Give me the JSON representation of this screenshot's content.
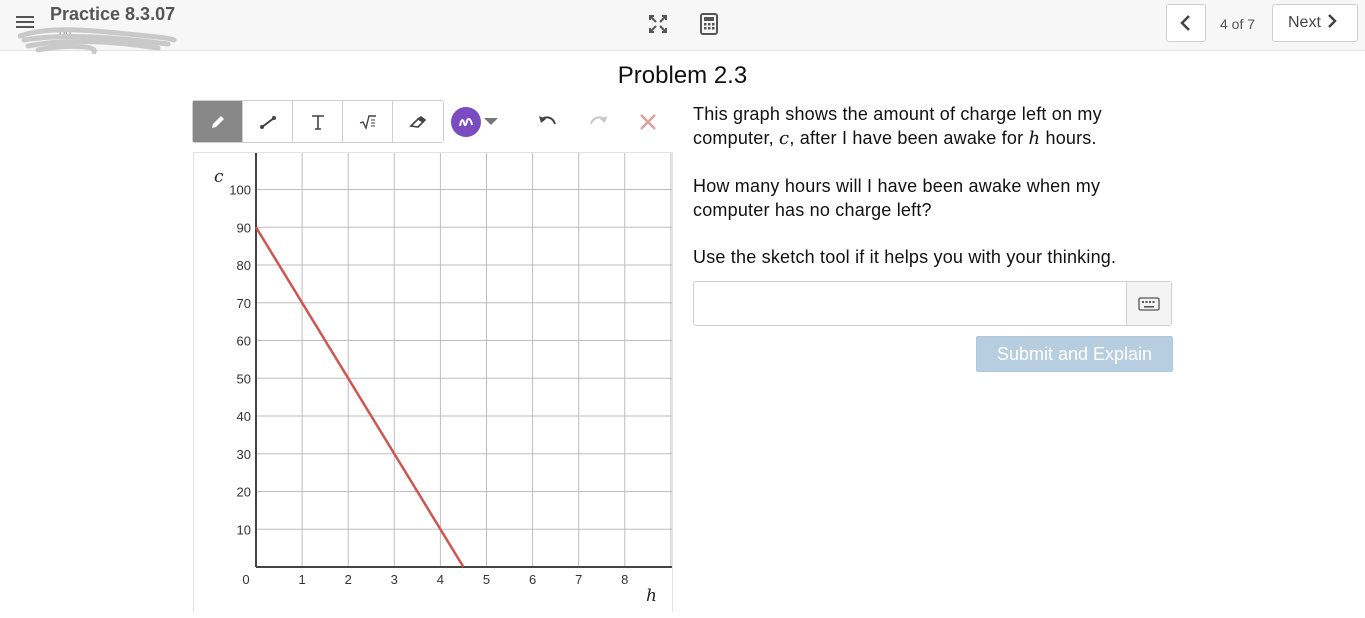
{
  "header": {
    "title": "Practice 8.3.07",
    "subtitle": "...on",
    "icons": {
      "menu": "hamburger-menu-icon",
      "expand": "expand-icon",
      "calculator": "calculator-icon"
    }
  },
  "nav": {
    "counter": "4 of 7",
    "next_label": "Next",
    "prev_icon": "chevron-left-icon",
    "next_icon": "chevron-right-icon"
  },
  "problem": {
    "title": "Problem 2.3"
  },
  "sketch_tools": {
    "tools": [
      "pencil-icon",
      "line-icon",
      "text-icon",
      "math-icon",
      "eraser-icon"
    ],
    "active_tool": "pencil",
    "pen_color": "#7b4bc2",
    "actions": [
      "undo-icon",
      "redo-icon",
      "clear-icon"
    ]
  },
  "question": {
    "line1_a": "This graph shows the amount of charge left on my computer,",
    "var_c": "c",
    "line1_b": ", after I have been awake for",
    "var_h": "h",
    "line1_c": "hours.",
    "line2": "How many hours will I have been awake when my computer has no charge left?",
    "line3": "Use the sketch tool if it helps you with your thinking."
  },
  "answer": {
    "value": "",
    "placeholder": "",
    "keyboard_icon": "keyboard-icon"
  },
  "submit_label": "Submit and Explain",
  "chart_data": {
    "type": "line",
    "xlabel": "h",
    "ylabel": "c",
    "x_ticks": [
      "0",
      "1",
      "2",
      "3",
      "4",
      "5",
      "6",
      "7",
      "8"
    ],
    "y_ticks": [
      "10",
      "20",
      "30",
      "40",
      "50",
      "60",
      "70",
      "80",
      "90",
      "100"
    ],
    "xlim": [
      0,
      9
    ],
    "ylim": [
      0,
      105
    ],
    "grid": true,
    "line_color": "#d0554e",
    "series": [
      {
        "x": [
          0,
          4.5
        ],
        "y": [
          90,
          0
        ]
      }
    ]
  }
}
